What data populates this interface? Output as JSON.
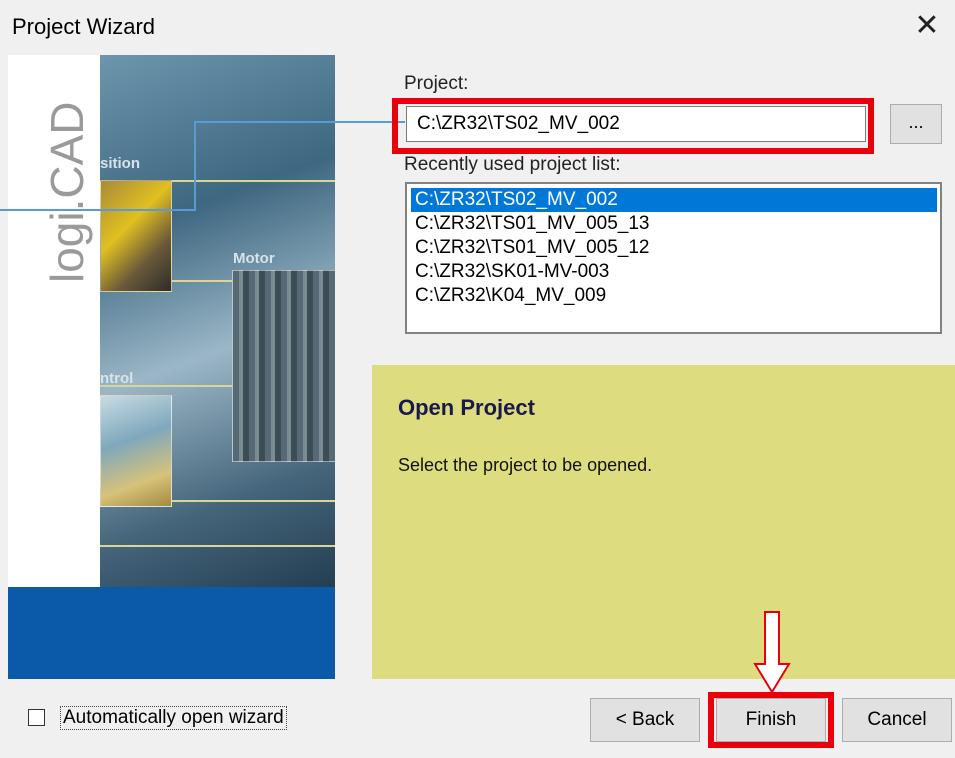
{
  "window": {
    "title": "Project Wizard",
    "close_glyph": "✕"
  },
  "banner": {
    "logo": "logi.CAD",
    "image_labels": [
      "sition",
      "Motor",
      "ntrol"
    ]
  },
  "project": {
    "label": "Project:",
    "value": "C:\\ZR32\\TS02_MV_002",
    "browse_label": "..."
  },
  "recent": {
    "label": "Recently used project list:",
    "items": [
      "C:\\ZR32\\TS02_MV_002",
      "C:\\ZR32\\TS01_MV_005_13",
      "C:\\ZR32\\TS01_MV_005_12",
      "C:\\ZR32\\SK01-MV-003",
      "C:\\ZR32\\K04_MV_009"
    ],
    "selected_index": 0
  },
  "info": {
    "title": "Open Project",
    "text": "Select the project to be opened."
  },
  "footer": {
    "auto_open_label": "Automatically open wizard",
    "auto_open_checked": false,
    "back_label": "< Back",
    "finish_label": "Finish",
    "cancel_label": "Cancel"
  },
  "colors": {
    "highlight_red": "#e8000b",
    "selection_blue": "#0078d7",
    "info_panel": "#dddd80",
    "banner_blue": "#0b5aa9"
  }
}
